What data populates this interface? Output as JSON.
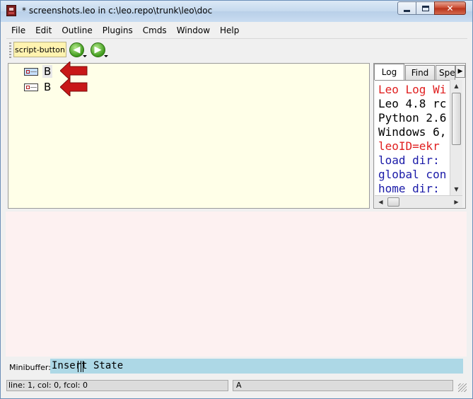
{
  "window": {
    "title": "* screenshots.leo in c:\\leo.repo\\trunk\\leo\\doc"
  },
  "menubar": {
    "items": [
      "File",
      "Edit",
      "Outline",
      "Plugins",
      "Cmds",
      "Window",
      "Help"
    ]
  },
  "toolbar": {
    "script_button_label": "script-button"
  },
  "outline": {
    "nodes": [
      {
        "label": "B",
        "selected": true
      },
      {
        "label": "B",
        "selected": false
      }
    ]
  },
  "log": {
    "tabs": [
      "Log",
      "Find",
      "Spe"
    ],
    "lines": [
      {
        "text": "Leo Log Wi",
        "color": "#e02020"
      },
      {
        "text": "Leo 4.8 rc",
        "color": "#000000"
      },
      {
        "text": "Python 2.6",
        "color": "#000000"
      },
      {
        "text": "Windows 6,",
        "color": "#000000"
      },
      {
        "text": "leoID=ekr",
        "color": "#e02020"
      },
      {
        "text": "load dir:",
        "color": "#1a1aa8"
      },
      {
        "text": "global con",
        "color": "#1a1aa8"
      },
      {
        "text": "home dir:",
        "color": "#1a1aa8"
      }
    ]
  },
  "minibuffer": {
    "label": "Minibuffer:",
    "value": "Insert State"
  },
  "status": {
    "left": "line: 1, col: 0, fcol: 0",
    "right": "A"
  },
  "colors": {
    "outline_bg": "#ffffe8",
    "body_bg": "#fdf1f1",
    "minibuffer_bg": "#add8e6",
    "script_button_bg": "#fff3b0",
    "arrow": "#c81818"
  }
}
